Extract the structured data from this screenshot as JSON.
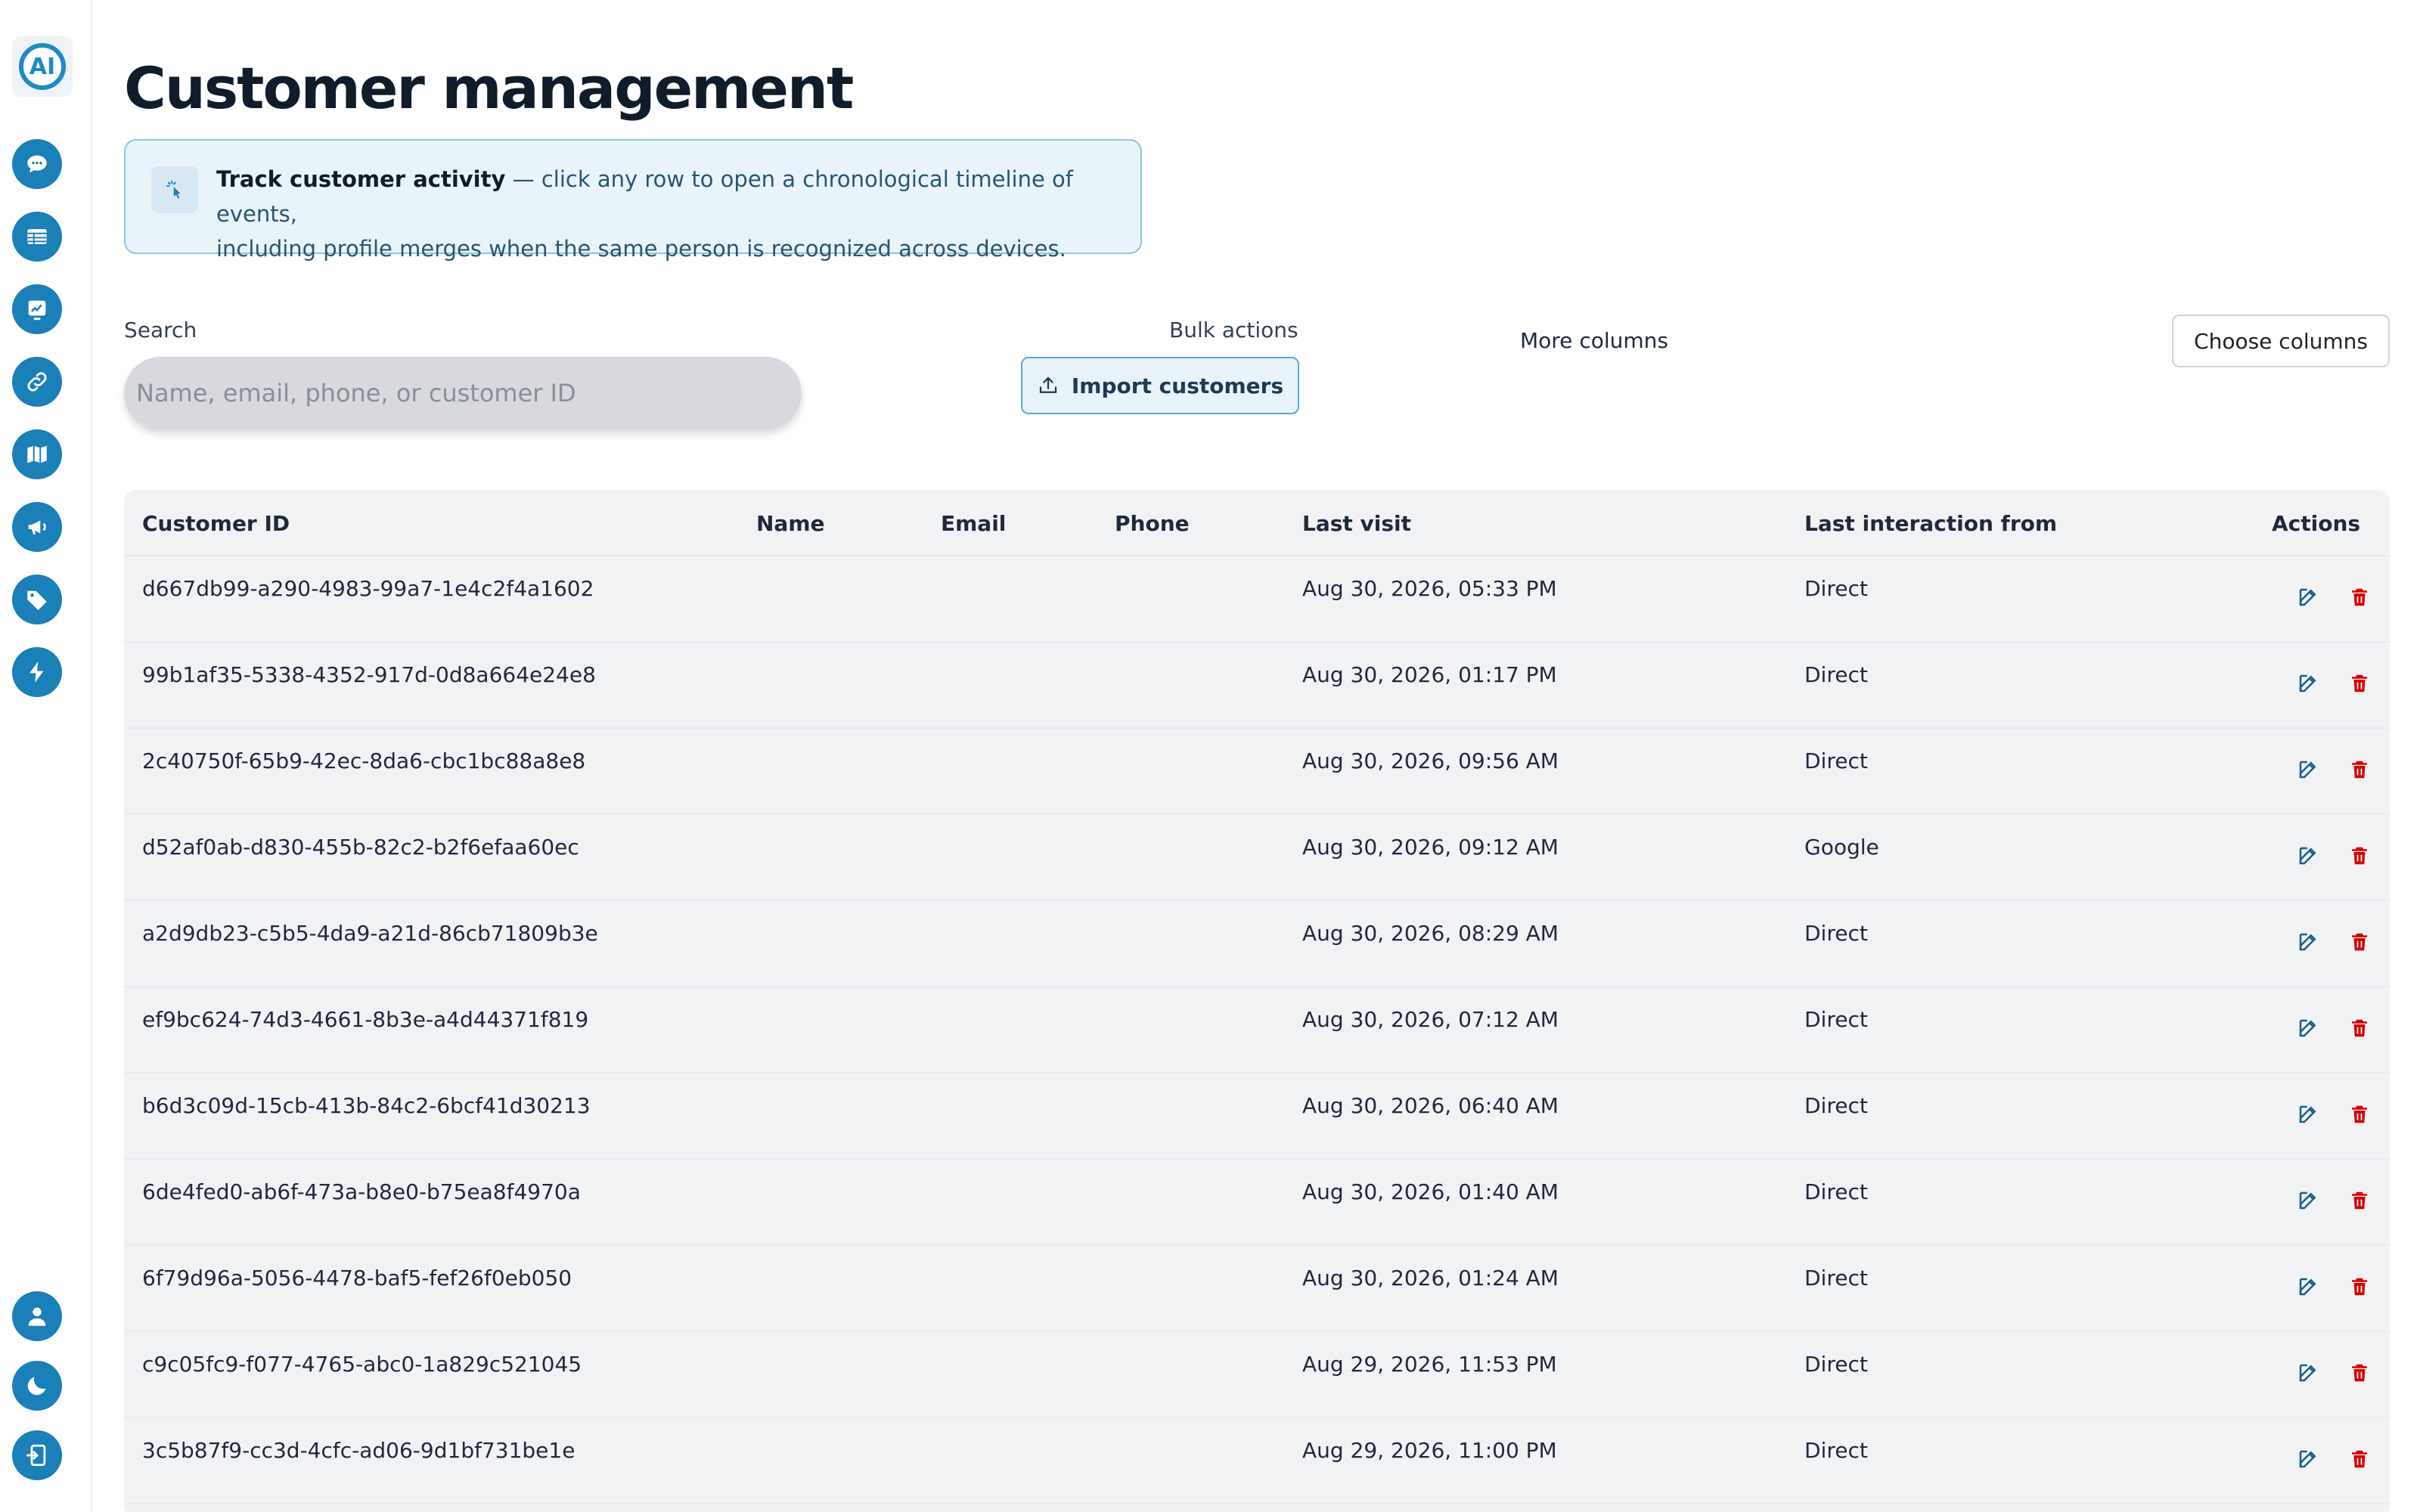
{
  "app": {
    "logo_text": "AI"
  },
  "sidebar": {
    "top_items": [
      {
        "icon": "chat-bubble-icon"
      },
      {
        "icon": "table-icon"
      },
      {
        "icon": "analytics-chart-icon"
      },
      {
        "icon": "link-icon"
      },
      {
        "icon": "map-icon"
      },
      {
        "icon": "megaphone-icon"
      },
      {
        "icon": "tag-icon"
      },
      {
        "icon": "lightning-icon"
      }
    ],
    "bottom_items": [
      {
        "icon": "user-icon"
      },
      {
        "icon": "moon-icon"
      },
      {
        "icon": "logout-icon"
      }
    ]
  },
  "page": {
    "title": "Customer management"
  },
  "info": {
    "title": "Track customer activity",
    "text": " — click any row to open a chronological timeline of events,",
    "text2": "including profile merges when the same person is recognized across devices."
  },
  "toolbar": {
    "search_label": "Search",
    "search_placeholder": "Name, email, phone, or customer ID",
    "bulk_label": "Bulk actions",
    "import_label": "Import customers",
    "more_columns_label": "More columns",
    "choose_columns_label": "Choose columns"
  },
  "table": {
    "headers": {
      "id": "Customer ID",
      "name": "Name",
      "email": "Email",
      "phone": "Phone",
      "last_visit": "Last visit",
      "source": "Last interaction from",
      "actions": "Actions"
    },
    "rows": [
      {
        "id": "d667db99-a290-4983-99a7-1e4c2f4a1602",
        "last_visit": "Aug 30, 2026, 05:33 PM",
        "source": "Direct"
      },
      {
        "id": "99b1af35-5338-4352-917d-0d8a664e24e8",
        "last_visit": "Aug 30, 2026, 01:17 PM",
        "source": "Direct"
      },
      {
        "id": "2c40750f-65b9-42ec-8da6-cbc1bc88a8e8",
        "last_visit": "Aug 30, 2026, 09:56 AM",
        "source": "Direct"
      },
      {
        "id": "d52af0ab-d830-455b-82c2-b2f6efaa60ec",
        "last_visit": "Aug 30, 2026, 09:12 AM",
        "source": "Google"
      },
      {
        "id": "a2d9db23-c5b5-4da9-a21d-86cb71809b3e",
        "last_visit": "Aug 30, 2026, 08:29 AM",
        "source": "Direct"
      },
      {
        "id": "ef9bc624-74d3-4661-8b3e-a4d44371f819",
        "last_visit": "Aug 30, 2026, 07:12 AM",
        "source": "Direct"
      },
      {
        "id": "b6d3c09d-15cb-413b-84c2-6bcf41d30213",
        "last_visit": "Aug 30, 2026, 06:40 AM",
        "source": "Direct"
      },
      {
        "id": "6de4fed0-ab6f-473a-b8e0-b75ea8f4970a",
        "last_visit": "Aug 30, 2026, 01:40 AM",
        "source": "Direct"
      },
      {
        "id": "6f79d96a-5056-4478-baf5-fef26f0eb050",
        "last_visit": "Aug 30, 2026, 01:24 AM",
        "source": "Direct"
      },
      {
        "id": "c9c05fc9-f077-4765-abc0-1a829c521045",
        "last_visit": "Aug 29, 2026, 11:53 PM",
        "source": "Direct"
      },
      {
        "id": "3c5b87f9-cc3d-4cfc-ad06-9d1bf731be1e",
        "last_visit": "Aug 29, 2026, 11:00 PM",
        "source": "Direct"
      }
    ]
  },
  "colors": {
    "accent": "#1b7fb8",
    "danger": "#d60000",
    "edit": "#1b5f86"
  }
}
